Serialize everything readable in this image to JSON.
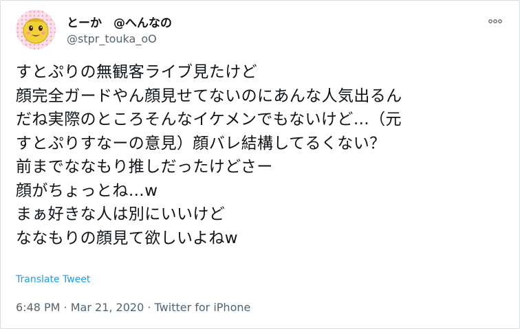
{
  "author": {
    "display_name": "とーか　@へんなの",
    "handle": "@stpr_touka_oO",
    "avatar_icon": "cartoon-face-avatar"
  },
  "menu": {
    "icon": "more-horizontal-icon"
  },
  "tweet": {
    "lines": [
      "すとぷりの無観客ライブ見たけど",
      "顔完全ガードやん顔見せてないのにあんな人気出るん",
      "だね実際のところそんなイケメンでもないけど…（元",
      "すとぷりすなーの意見）顔バレ結構してるくない？",
      "前までななもり推しだったけどさー",
      "顔がちょっとね…w",
      "まぁ好きな人は別にいいけど",
      "ななもりの顔見て欲しいよねw"
    ],
    "translate_label": "Translate Tweet"
  },
  "meta": {
    "time": "6:48 PM",
    "separator": " · ",
    "date": "Mar 21, 2020",
    "source": "Twitter for iPhone"
  },
  "colors": {
    "text": "#0f1419",
    "secondary": "#536471",
    "link": "#1d9bf0",
    "border": "#d8dde1",
    "avatar_background": "#f7c7d9",
    "avatar_face": "#f2d23a"
  }
}
